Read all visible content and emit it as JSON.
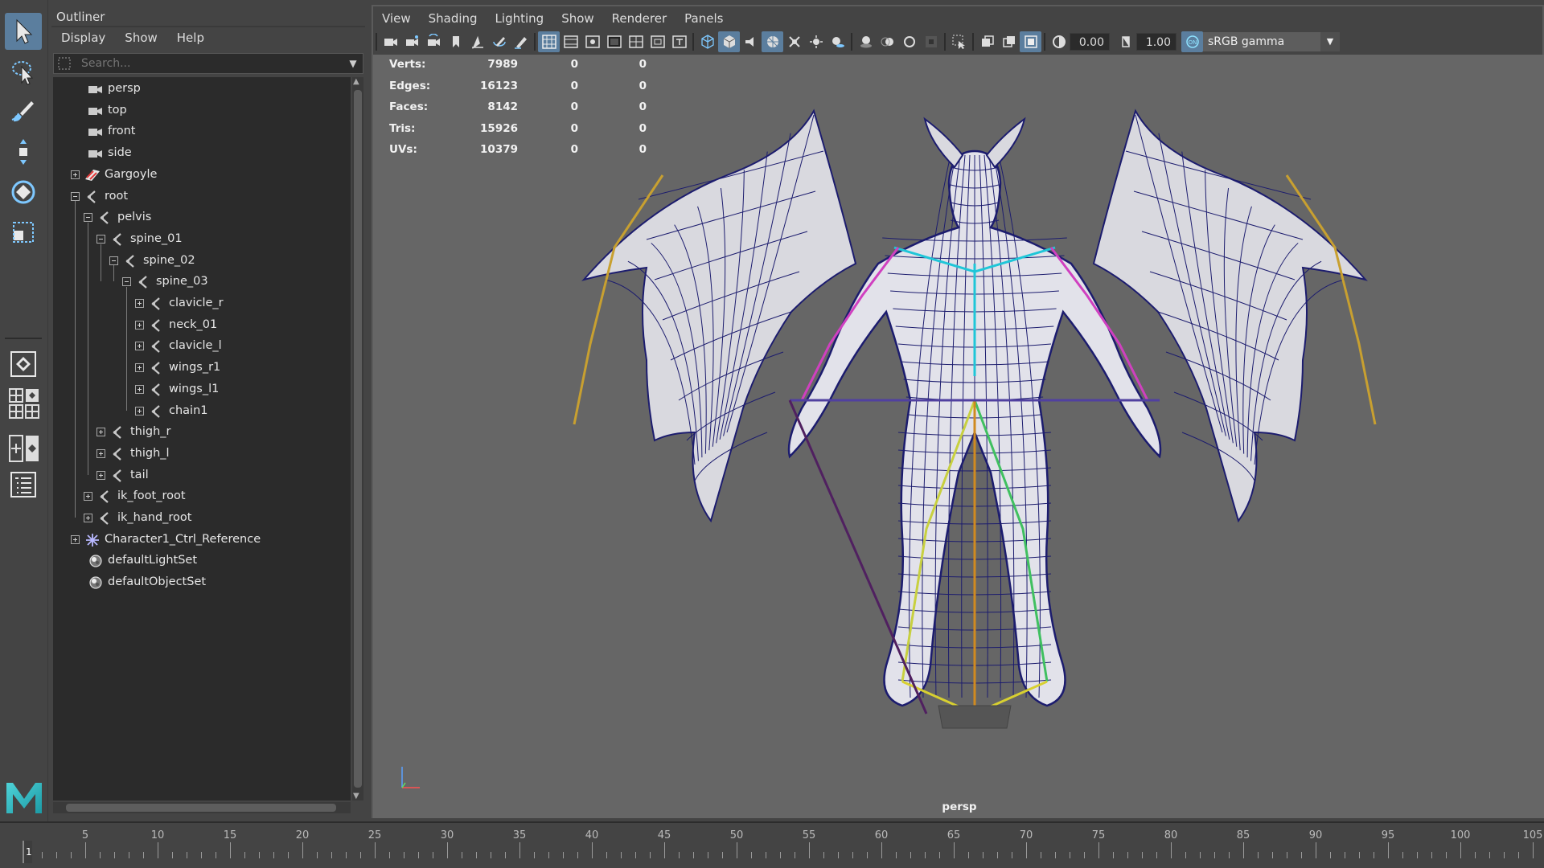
{
  "outliner": {
    "title": "Outliner",
    "menu": [
      "Display",
      "Show",
      "Help"
    ],
    "search_placeholder": "Search...",
    "items": [
      {
        "label": "persp",
        "icon": "camera-icon",
        "depth": 0,
        "expander": "none"
      },
      {
        "label": "top",
        "icon": "camera-icon",
        "depth": 0,
        "expander": "none"
      },
      {
        "label": "front",
        "icon": "camera-icon",
        "depth": 0,
        "expander": "none"
      },
      {
        "label": "side",
        "icon": "camera-icon",
        "depth": 0,
        "expander": "none"
      },
      {
        "label": "Gargoyle",
        "icon": "mesh-icon",
        "depth": 0,
        "expander": "plus"
      },
      {
        "label": "root",
        "icon": "joint-icon",
        "depth": 0,
        "expander": "minus"
      },
      {
        "label": "pelvis",
        "icon": "joint-icon",
        "depth": 1,
        "expander": "minus"
      },
      {
        "label": "spine_01",
        "icon": "joint-icon",
        "depth": 2,
        "expander": "minus"
      },
      {
        "label": "spine_02",
        "icon": "joint-icon",
        "depth": 3,
        "expander": "minus"
      },
      {
        "label": "spine_03",
        "icon": "joint-icon",
        "depth": 4,
        "expander": "minus"
      },
      {
        "label": "clavicle_r",
        "icon": "joint-icon",
        "depth": 5,
        "expander": "plus"
      },
      {
        "label": "neck_01",
        "icon": "joint-icon",
        "depth": 5,
        "expander": "plus"
      },
      {
        "label": "clavicle_l",
        "icon": "joint-icon",
        "depth": 5,
        "expander": "plus"
      },
      {
        "label": "wings_r1",
        "icon": "joint-icon",
        "depth": 5,
        "expander": "plus"
      },
      {
        "label": "wings_l1",
        "icon": "joint-icon",
        "depth": 5,
        "expander": "plus"
      },
      {
        "label": "chain1",
        "icon": "joint-icon",
        "depth": 5,
        "expander": "plus"
      },
      {
        "label": "thigh_r",
        "icon": "joint-icon",
        "depth": 2,
        "expander": "plus"
      },
      {
        "label": "thigh_l",
        "icon": "joint-icon",
        "depth": 2,
        "expander": "plus"
      },
      {
        "label": "tail",
        "icon": "joint-icon",
        "depth": 2,
        "expander": "plus"
      },
      {
        "label": "ik_foot_root",
        "icon": "joint-icon",
        "depth": 1,
        "expander": "plus"
      },
      {
        "label": "ik_hand_root",
        "icon": "joint-icon",
        "depth": 1,
        "expander": "plus"
      },
      {
        "label": "Character1_Ctrl_Reference",
        "icon": "hik-reference-icon",
        "depth": 0,
        "expander": "plus"
      },
      {
        "label": "defaultLightSet",
        "icon": "set-icon",
        "depth": 0,
        "expander": "none"
      },
      {
        "label": "defaultObjectSet",
        "icon": "set-icon",
        "depth": 0,
        "expander": "none"
      }
    ]
  },
  "viewport": {
    "menu": [
      "View",
      "Shading",
      "Lighting",
      "Show",
      "Renderer",
      "Panels"
    ],
    "exposure": "0.00",
    "gamma": "1.00",
    "color_space": "sRGB gamma",
    "camera": "persp",
    "stats": [
      {
        "label": "Verts:",
        "values": [
          "7989",
          "0",
          "0"
        ]
      },
      {
        "label": "Edges:",
        "values": [
          "16123",
          "0",
          "0"
        ]
      },
      {
        "label": "Faces:",
        "values": [
          "8142",
          "0",
          "0"
        ]
      },
      {
        "label": "Tris:",
        "values": [
          "15926",
          "0",
          "0"
        ]
      },
      {
        "label": "UVs:",
        "values": [
          "10379",
          "0",
          "0"
        ]
      }
    ]
  },
  "timeline": {
    "current_frame": "1",
    "labels": [
      "5",
      "10",
      "15",
      "20",
      "25",
      "30",
      "35",
      "40",
      "45",
      "50",
      "55",
      "60",
      "65",
      "70",
      "75",
      "80",
      "85",
      "90",
      "95",
      "100",
      "105"
    ]
  },
  "colors": {
    "ui_bg": "#444444",
    "panel_dark": "#2b2b2b",
    "viewport_bg": "#666666",
    "highlight": "#5b7e9e",
    "wire": "#1c1c6e"
  }
}
